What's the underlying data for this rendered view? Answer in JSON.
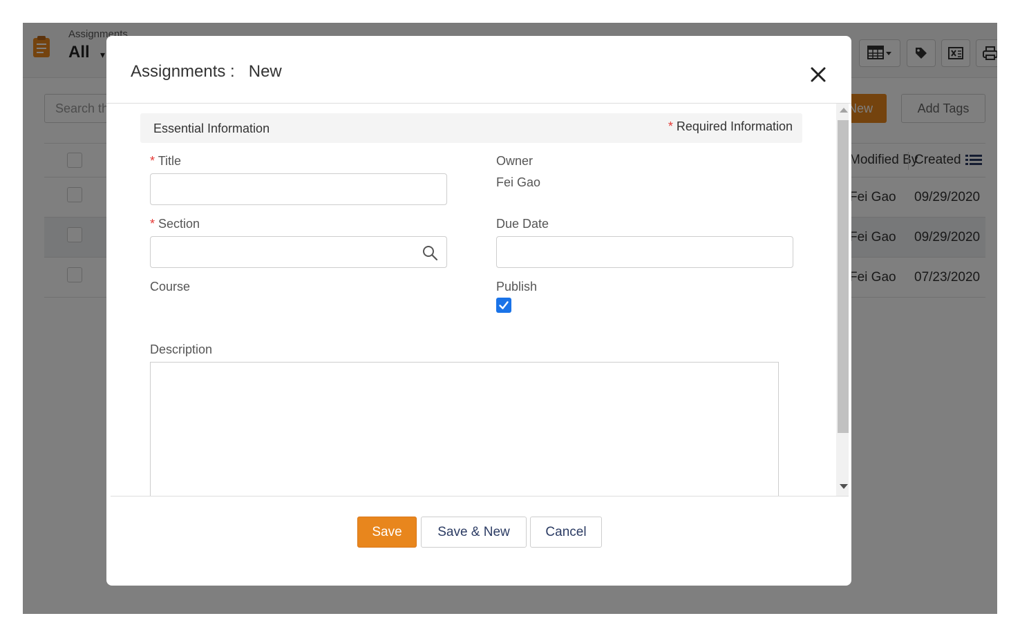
{
  "background": {
    "header": {
      "subtitle": "Assignments",
      "title": "All",
      "caret": "▾"
    },
    "search_placeholder": "Search this list",
    "new_label": "New",
    "add_tags_label": "Add Tags",
    "grid": {
      "headers": {
        "modified_by": "Modified By",
        "created": "Created"
      },
      "rows": [
        {
          "modified_by": "Fei Gao",
          "created": "09/29/2020"
        },
        {
          "modified_by": "Fei Gao",
          "created": "09/29/2020"
        },
        {
          "modified_by": "Fei Gao",
          "created": "07/23/2020"
        }
      ]
    }
  },
  "modal": {
    "title": "Assignments :   New",
    "section_title": "Essential Information",
    "required_star": "*",
    "required_info": "Required Information",
    "fields": {
      "title": {
        "label": "Title",
        "value": ""
      },
      "owner": {
        "label": "Owner",
        "value": "Fei Gao"
      },
      "section": {
        "label": "Section",
        "value": ""
      },
      "due_date": {
        "label": "Due Date",
        "value": ""
      },
      "course": {
        "label": "Course"
      },
      "publish": {
        "label": "Publish",
        "checked": true
      },
      "description": {
        "label": "Description",
        "value": ""
      }
    },
    "buttons": {
      "save": "Save",
      "save_new": "Save & New",
      "cancel": "Cancel"
    }
  },
  "colors": {
    "accent": "#e8861d",
    "checkbox": "#1a73e8",
    "required": "#e53935"
  }
}
